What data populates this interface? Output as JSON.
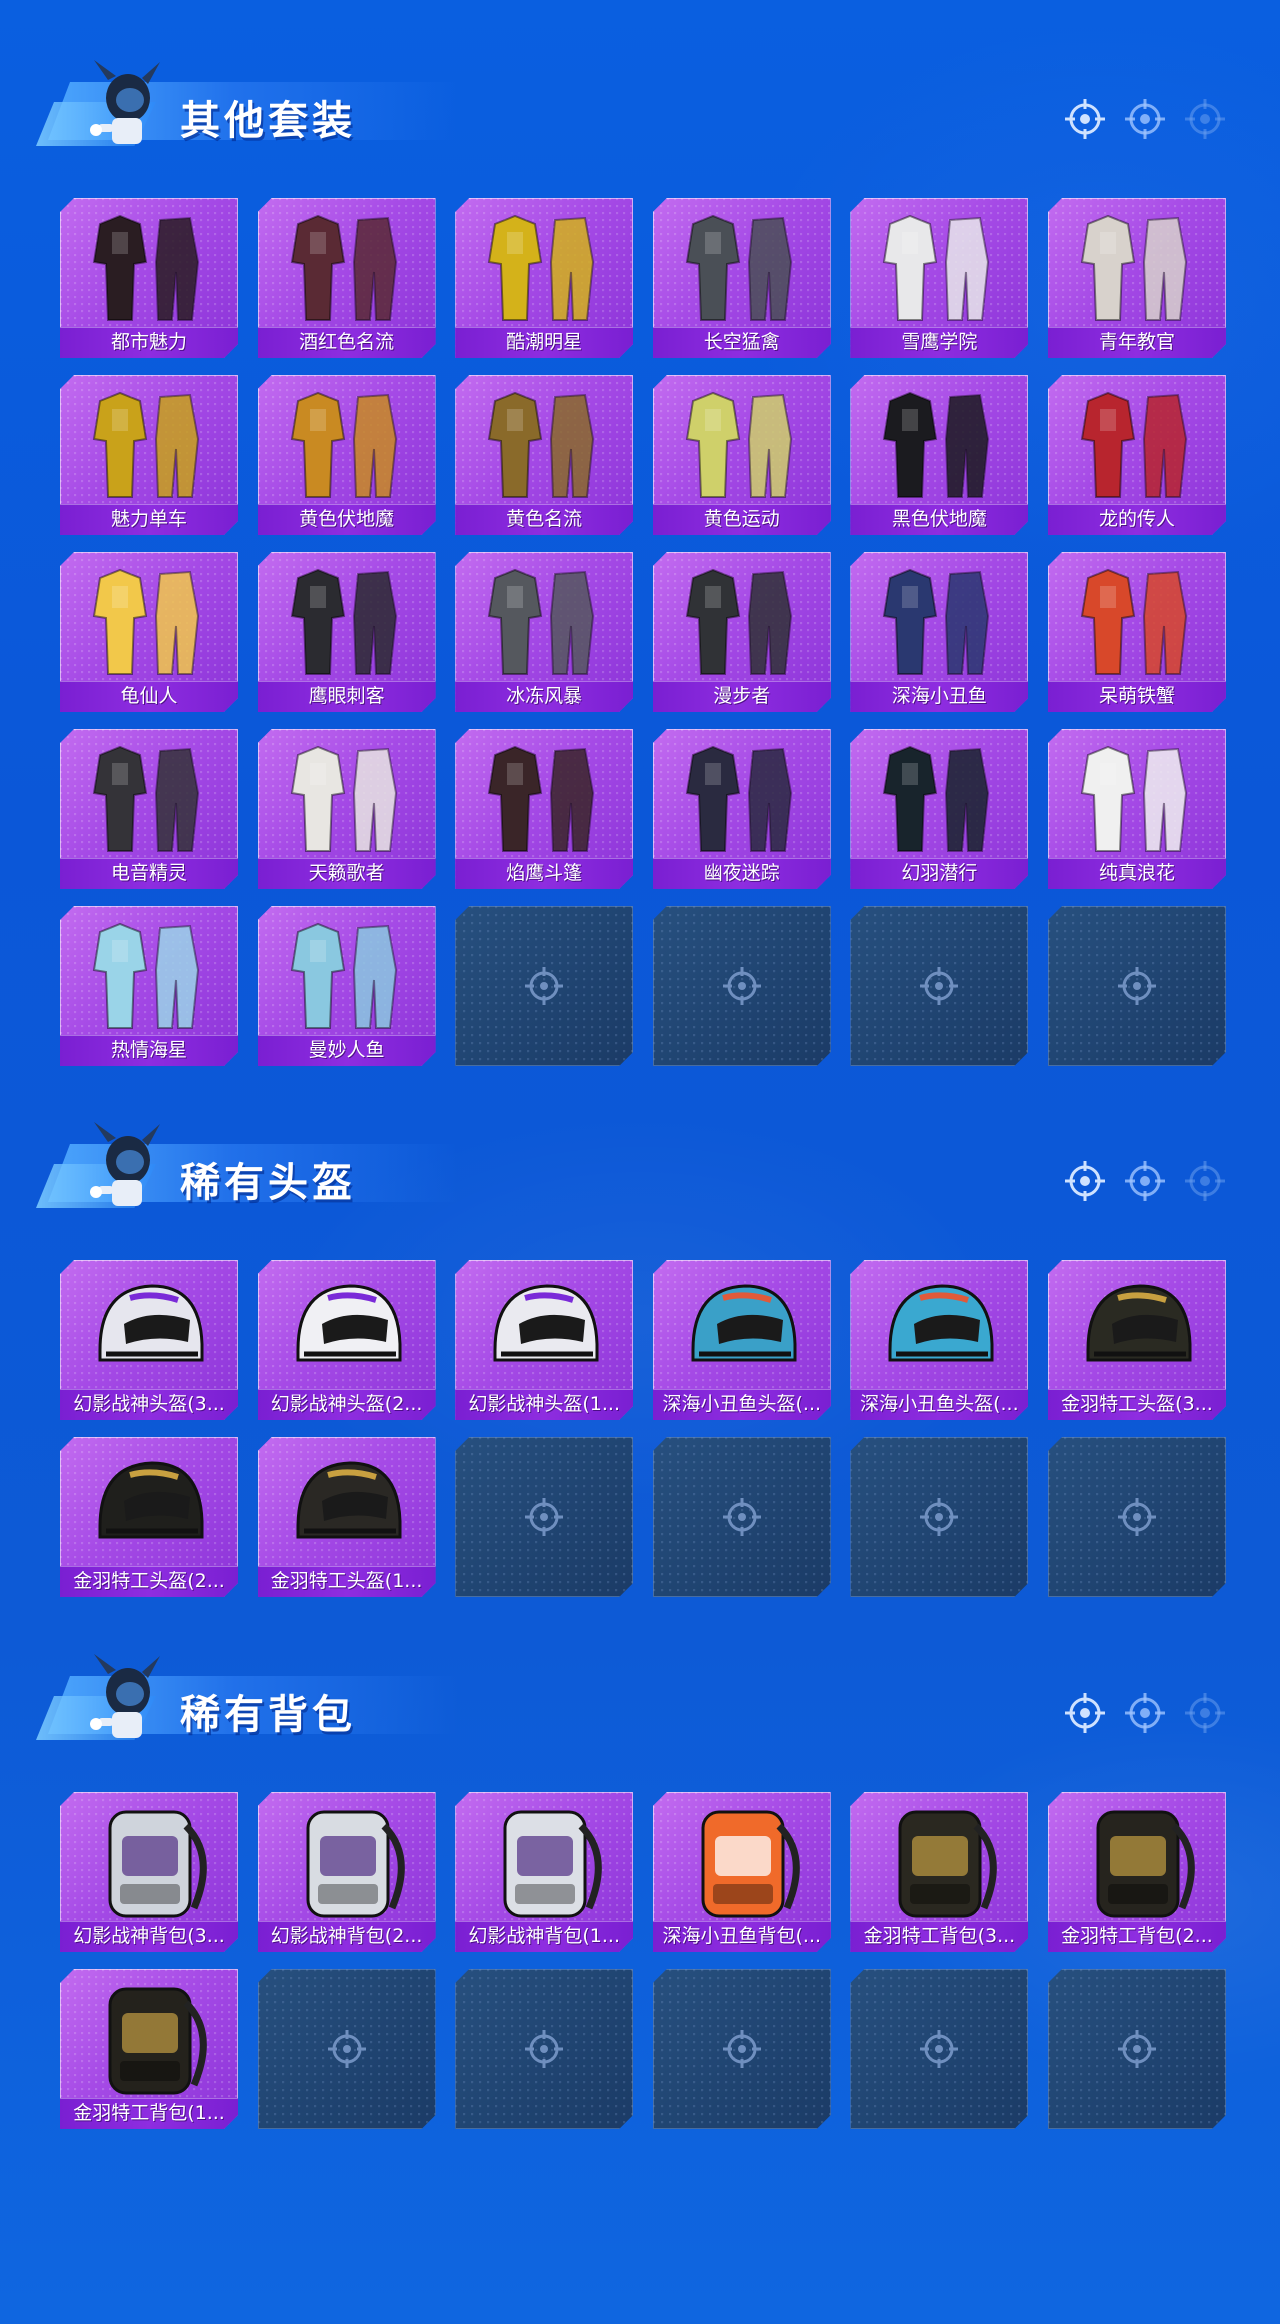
{
  "sections": [
    {
      "title": "其他套装",
      "items": [
        "都市魅力",
        "酒红色名流",
        "酷潮明星",
        "长空猛禽",
        "雪鹰学院",
        "青年教官",
        "魅力单车",
        "黄色伏地魔",
        "黄色名流",
        "黄色运动",
        "黑色伏地魔",
        "龙的传人",
        "龟仙人",
        "鹰眼刺客",
        "冰冻风暴",
        "漫步者",
        "深海小丑鱼",
        "呆萌铁蟹",
        "电音精灵",
        "天籁歌者",
        "焰鹰斗篷",
        "幽夜迷踪",
        "幻羽潜行",
        "纯真浪花",
        "热情海星",
        "曼妙人鱼"
      ],
      "empty_slots": 4
    },
    {
      "title": "稀有头盔",
      "items": [
        "幻影战神头盔(3...",
        "幻影战神头盔(2...",
        "幻影战神头盔(1...",
        "深海小丑鱼头盔(...",
        "深海小丑鱼头盔(...",
        "金羽特工头盔(3...",
        "金羽特工头盔(2...",
        "金羽特工头盔(1..."
      ],
      "empty_slots": 4
    },
    {
      "title": "稀有背包",
      "items": [
        "幻影战神背包(3...",
        "幻影战神背包(2...",
        "幻影战神背包(1...",
        "深海小丑鱼背包(...",
        "金羽特工背包(3...",
        "金羽特工背包(2...",
        "金羽特工背包(1..."
      ],
      "empty_slots": 5
    }
  ],
  "colors": {
    "background": "#0b57d8",
    "card_purple": "#a54ae6",
    "label_bar": "#7a1fd2",
    "empty_slot": "#1f4370"
  }
}
